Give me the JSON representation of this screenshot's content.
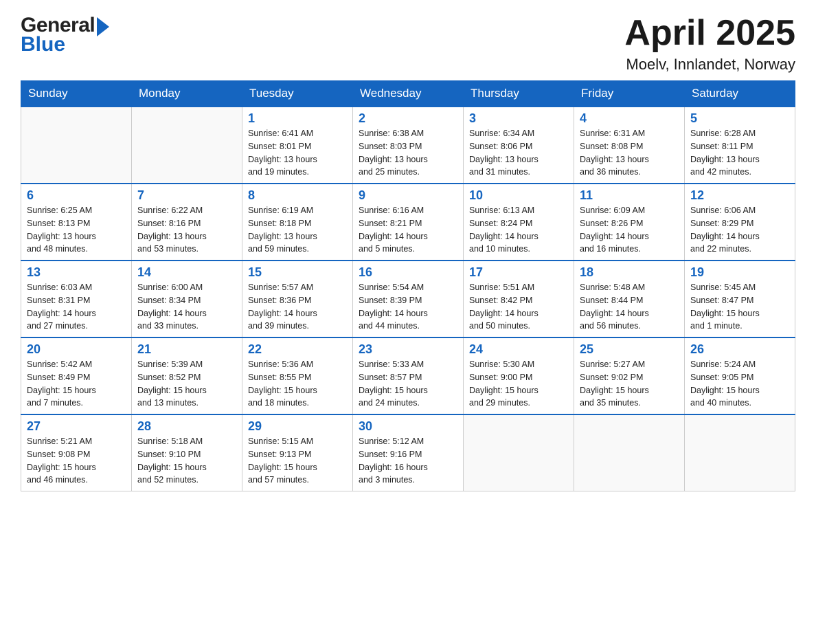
{
  "header": {
    "title": "April 2025",
    "location": "Moelv, Innlandet, Norway",
    "logo_general": "General",
    "logo_blue": "Blue"
  },
  "weekdays": [
    "Sunday",
    "Monday",
    "Tuesday",
    "Wednesday",
    "Thursday",
    "Friday",
    "Saturday"
  ],
  "weeks": [
    [
      {
        "day": "",
        "info": ""
      },
      {
        "day": "",
        "info": ""
      },
      {
        "day": "1",
        "info": "Sunrise: 6:41 AM\nSunset: 8:01 PM\nDaylight: 13 hours\nand 19 minutes."
      },
      {
        "day": "2",
        "info": "Sunrise: 6:38 AM\nSunset: 8:03 PM\nDaylight: 13 hours\nand 25 minutes."
      },
      {
        "day": "3",
        "info": "Sunrise: 6:34 AM\nSunset: 8:06 PM\nDaylight: 13 hours\nand 31 minutes."
      },
      {
        "day": "4",
        "info": "Sunrise: 6:31 AM\nSunset: 8:08 PM\nDaylight: 13 hours\nand 36 minutes."
      },
      {
        "day": "5",
        "info": "Sunrise: 6:28 AM\nSunset: 8:11 PM\nDaylight: 13 hours\nand 42 minutes."
      }
    ],
    [
      {
        "day": "6",
        "info": "Sunrise: 6:25 AM\nSunset: 8:13 PM\nDaylight: 13 hours\nand 48 minutes."
      },
      {
        "day": "7",
        "info": "Sunrise: 6:22 AM\nSunset: 8:16 PM\nDaylight: 13 hours\nand 53 minutes."
      },
      {
        "day": "8",
        "info": "Sunrise: 6:19 AM\nSunset: 8:18 PM\nDaylight: 13 hours\nand 59 minutes."
      },
      {
        "day": "9",
        "info": "Sunrise: 6:16 AM\nSunset: 8:21 PM\nDaylight: 14 hours\nand 5 minutes."
      },
      {
        "day": "10",
        "info": "Sunrise: 6:13 AM\nSunset: 8:24 PM\nDaylight: 14 hours\nand 10 minutes."
      },
      {
        "day": "11",
        "info": "Sunrise: 6:09 AM\nSunset: 8:26 PM\nDaylight: 14 hours\nand 16 minutes."
      },
      {
        "day": "12",
        "info": "Sunrise: 6:06 AM\nSunset: 8:29 PM\nDaylight: 14 hours\nand 22 minutes."
      }
    ],
    [
      {
        "day": "13",
        "info": "Sunrise: 6:03 AM\nSunset: 8:31 PM\nDaylight: 14 hours\nand 27 minutes."
      },
      {
        "day": "14",
        "info": "Sunrise: 6:00 AM\nSunset: 8:34 PM\nDaylight: 14 hours\nand 33 minutes."
      },
      {
        "day": "15",
        "info": "Sunrise: 5:57 AM\nSunset: 8:36 PM\nDaylight: 14 hours\nand 39 minutes."
      },
      {
        "day": "16",
        "info": "Sunrise: 5:54 AM\nSunset: 8:39 PM\nDaylight: 14 hours\nand 44 minutes."
      },
      {
        "day": "17",
        "info": "Sunrise: 5:51 AM\nSunset: 8:42 PM\nDaylight: 14 hours\nand 50 minutes."
      },
      {
        "day": "18",
        "info": "Sunrise: 5:48 AM\nSunset: 8:44 PM\nDaylight: 14 hours\nand 56 minutes."
      },
      {
        "day": "19",
        "info": "Sunrise: 5:45 AM\nSunset: 8:47 PM\nDaylight: 15 hours\nand 1 minute."
      }
    ],
    [
      {
        "day": "20",
        "info": "Sunrise: 5:42 AM\nSunset: 8:49 PM\nDaylight: 15 hours\nand 7 minutes."
      },
      {
        "day": "21",
        "info": "Sunrise: 5:39 AM\nSunset: 8:52 PM\nDaylight: 15 hours\nand 13 minutes."
      },
      {
        "day": "22",
        "info": "Sunrise: 5:36 AM\nSunset: 8:55 PM\nDaylight: 15 hours\nand 18 minutes."
      },
      {
        "day": "23",
        "info": "Sunrise: 5:33 AM\nSunset: 8:57 PM\nDaylight: 15 hours\nand 24 minutes."
      },
      {
        "day": "24",
        "info": "Sunrise: 5:30 AM\nSunset: 9:00 PM\nDaylight: 15 hours\nand 29 minutes."
      },
      {
        "day": "25",
        "info": "Sunrise: 5:27 AM\nSunset: 9:02 PM\nDaylight: 15 hours\nand 35 minutes."
      },
      {
        "day": "26",
        "info": "Sunrise: 5:24 AM\nSunset: 9:05 PM\nDaylight: 15 hours\nand 40 minutes."
      }
    ],
    [
      {
        "day": "27",
        "info": "Sunrise: 5:21 AM\nSunset: 9:08 PM\nDaylight: 15 hours\nand 46 minutes."
      },
      {
        "day": "28",
        "info": "Sunrise: 5:18 AM\nSunset: 9:10 PM\nDaylight: 15 hours\nand 52 minutes."
      },
      {
        "day": "29",
        "info": "Sunrise: 5:15 AM\nSunset: 9:13 PM\nDaylight: 15 hours\nand 57 minutes."
      },
      {
        "day": "30",
        "info": "Sunrise: 5:12 AM\nSunset: 9:16 PM\nDaylight: 16 hours\nand 3 minutes."
      },
      {
        "day": "",
        "info": ""
      },
      {
        "day": "",
        "info": ""
      },
      {
        "day": "",
        "info": ""
      }
    ]
  ]
}
